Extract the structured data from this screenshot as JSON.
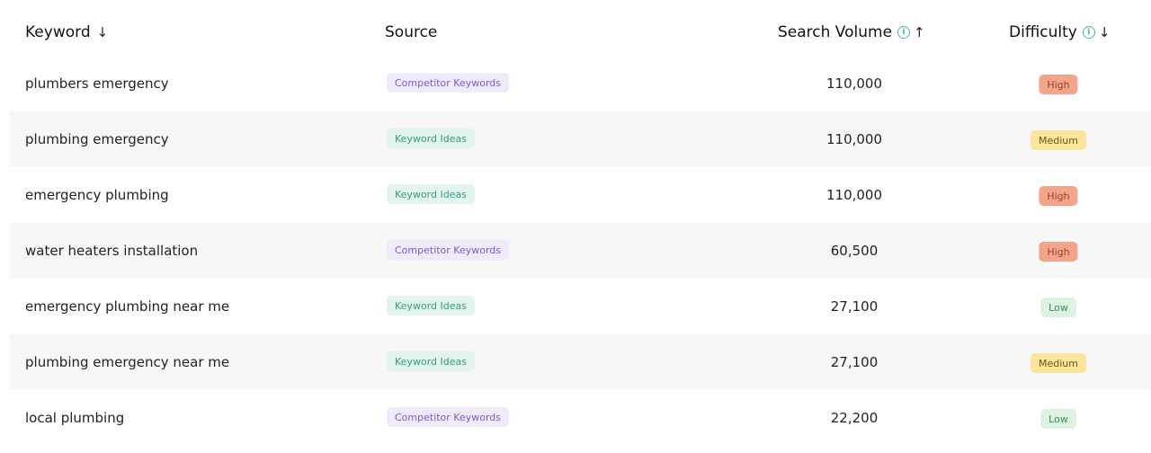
{
  "header": {
    "keyword": "Keyword",
    "keyword_sort": "↓",
    "source": "Source",
    "search_volume": "Search Volume",
    "search_volume_info": "i",
    "search_volume_sort": "↑",
    "difficulty": "Difficulty",
    "difficulty_info": "i",
    "difficulty_sort": "↓"
  },
  "rows": [
    {
      "keyword": "plumbers emergency",
      "source": "Competitor Keywords",
      "source_type": "competitor",
      "volume": "110,000",
      "difficulty": "High",
      "difficulty_level": "high"
    },
    {
      "keyword": "plumbing emergency",
      "source": "Keyword Ideas",
      "source_type": "ideas",
      "volume": "110,000",
      "difficulty": "Medium",
      "difficulty_level": "medium"
    },
    {
      "keyword": "emergency plumbing",
      "source": "Keyword Ideas",
      "source_type": "ideas",
      "volume": "110,000",
      "difficulty": "High",
      "difficulty_level": "high"
    },
    {
      "keyword": "water heaters installation",
      "source": "Competitor Keywords",
      "source_type": "competitor",
      "volume": "60,500",
      "difficulty": "High",
      "difficulty_level": "high"
    },
    {
      "keyword": "emergency plumbing near me",
      "source": "Keyword Ideas",
      "source_type": "ideas",
      "volume": "27,100",
      "difficulty": "Low",
      "difficulty_level": "low"
    },
    {
      "keyword": "plumbing emergency near me",
      "source": "Keyword Ideas",
      "source_type": "ideas",
      "volume": "27,100",
      "difficulty": "Medium",
      "difficulty_level": "medium"
    },
    {
      "keyword": "local plumbing",
      "source": "Competitor Keywords",
      "source_type": "competitor",
      "volume": "22,200",
      "difficulty": "Low",
      "difficulty_level": "low"
    }
  ],
  "colors": {
    "competitor_tag_bg": "#efebfc",
    "ideas_tag_bg": "#e2f4ee",
    "high_bg": "#f3a58c",
    "medium_bg": "#fbe59a",
    "low_bg": "#dcf2e2",
    "info_icon": "#4fb3a0"
  }
}
